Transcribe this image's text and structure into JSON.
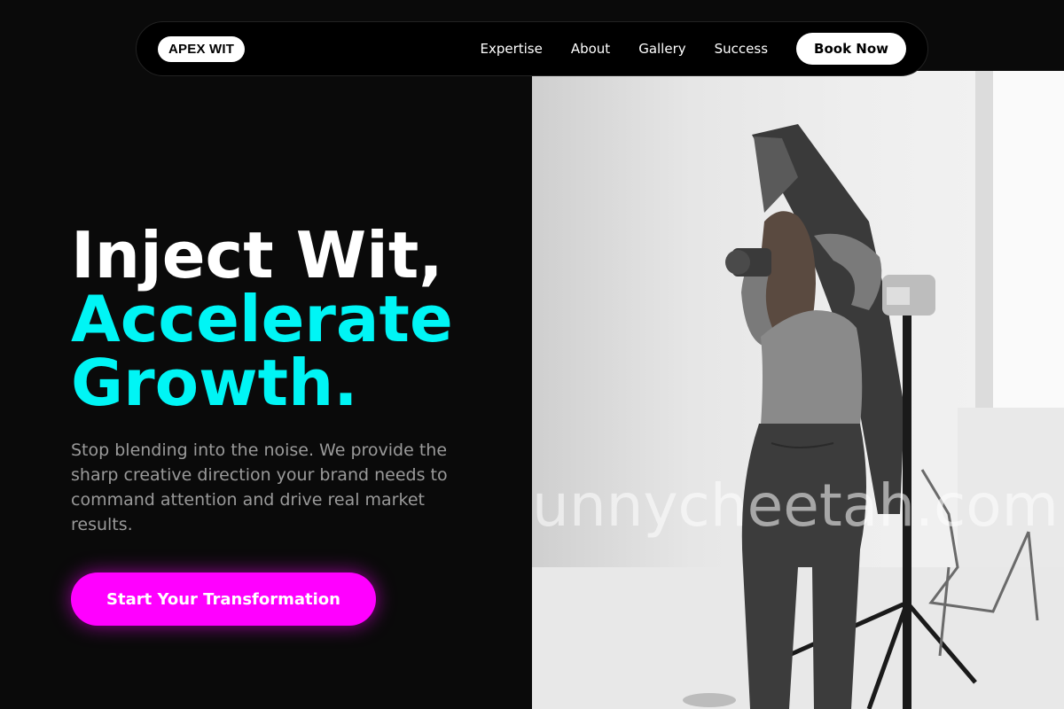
{
  "nav": {
    "logo": "APEX WIT",
    "links": [
      "Expertise",
      "About",
      "Gallery",
      "Success"
    ],
    "cta": "Book Now"
  },
  "hero": {
    "headline_line1": "Inject Wit,",
    "headline_line2": "Accelerate",
    "headline_line3": "Growth.",
    "subtext": "Stop blending into the noise. We provide the sharp creative direction your brand needs to command attention and drive real market results.",
    "cta": "Start Your Transformation",
    "image_watermark": "unnycheetah.com"
  },
  "colors": {
    "background": "#0a0a0a",
    "accent_cyan": "#00f5f5",
    "accent_magenta": "#ff00ff",
    "text_muted": "#9a9a9a"
  },
  "icons": {
    "hero_image": "photographer-studio-photo"
  }
}
